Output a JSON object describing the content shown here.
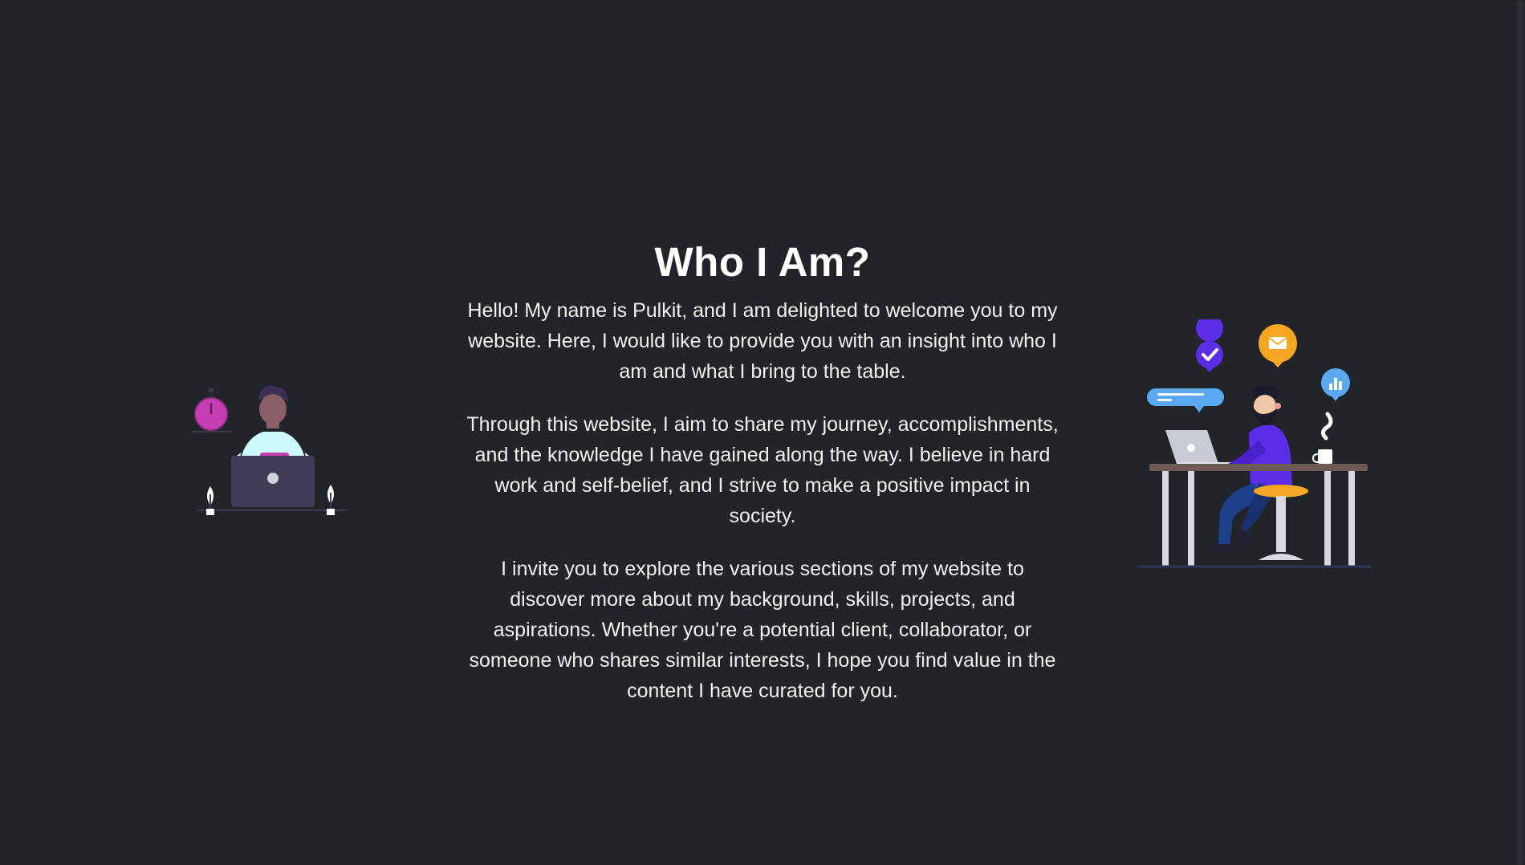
{
  "about": {
    "heading": "Who I Am?",
    "paragraphs": [
      "Hello! My name is Pulkit, and I am delighted to welcome you to my website. Here, I would like to provide you with an insight into who I am and what I bring to the table.",
      "Through this website, I aim to share my journey, accomplishments, and the knowledge I have gained along the way. I believe in hard work and self-belief, and I strive to make a positive impact in society.",
      "I invite you to explore the various sections of my website to discover more about my background, skills, projects, and aspirations. Whether you're a potential client, collaborator, or someone who shares similar interests, I hope you find value in the content I have curated for you."
    ]
  },
  "illustrations": {
    "left": "person-at-laptop-illustration",
    "right": "developer-at-desk-illustration"
  },
  "colors": {
    "background": "#212429",
    "text": "#ffffff",
    "accent_purple": "#5b2ee6",
    "accent_magenta": "#c53fb2",
    "accent_orange": "#f5a623",
    "accent_blue": "#5aa9f0"
  }
}
